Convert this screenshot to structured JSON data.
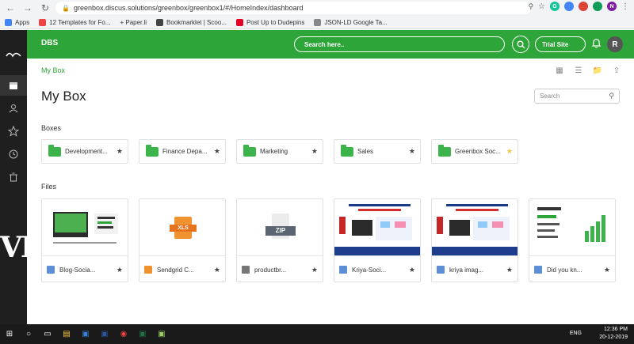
{
  "browser": {
    "url": "greenbox.discus.solutions/greenbox/greenbox1/#/HomeIndex/dashboard",
    "bookmarks": [
      "Apps",
      "12 Templates for Fo...",
      "+ Paper.li",
      "Bookmarklet | Scoo...",
      "Post Up to Dudepins",
      "JSON-LD Google Ta..."
    ]
  },
  "app": {
    "brand": "DBS",
    "search_placeholder": "Search here..",
    "trial_label": "Trial Site",
    "avatar_initial": "R",
    "rail_text": "VI"
  },
  "page": {
    "breadcrumb": "My Box",
    "title": "My Box",
    "search_placeholder": "Search",
    "boxes_label": "Boxes",
    "files_label": "Files"
  },
  "boxes": [
    {
      "name": "Development...",
      "favorite": false
    },
    {
      "name": "Finance Depa...",
      "favorite": false
    },
    {
      "name": "Marketing",
      "favorite": false
    },
    {
      "name": "Sales",
      "favorite": false
    },
    {
      "name": "Greenbox Soc...",
      "favorite": true
    }
  ],
  "files": [
    {
      "name": "Blog-Socia...",
      "type": "image"
    },
    {
      "name": "Sendgrid C...",
      "type": "xls"
    },
    {
      "name": "productbr...",
      "type": "zip"
    },
    {
      "name": "Kriya-Soci...",
      "type": "image"
    },
    {
      "name": "kriya imag...",
      "type": "image"
    },
    {
      "name": "Did you kn...",
      "type": "image"
    }
  ],
  "file_badges": {
    "xls": "XLS",
    "zip": "ZIP"
  },
  "taskbar": {
    "time": "12:36 PM",
    "date": "20-12-2019",
    "lang": "ENG"
  },
  "colors": {
    "primary": "#2ea538",
    "folder": "#3cb44b",
    "favorite": "#f5c242"
  }
}
